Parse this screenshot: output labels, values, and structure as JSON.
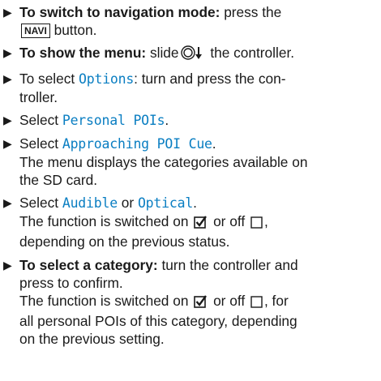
{
  "steps": [
    {
      "bold": "To switch to navigation mode:",
      "t1": " press the",
      "key": "NAVI",
      "t2": " button."
    },
    {
      "bold": "To show the menu:",
      "t1": " slide",
      "icon": "controller-slide-down-icon",
      "t2": " the controller."
    },
    {
      "t1": "To select ",
      "mono": "Options",
      "t2": ": turn and press the con-",
      "t3": "troller."
    },
    {
      "t1": "Select ",
      "mono": "Personal POIs",
      "t2": "."
    },
    {
      "t1": "Select ",
      "mono": "Approaching POI Cue",
      "t2": ".",
      "l2": "The menu displays the categories available on",
      "l3": "the SD card."
    },
    {
      "t1": "Select ",
      "mono1": "Audible",
      "t2": " or ",
      "mono2": "Optical",
      "t3": ".",
      "l2a": "The function is switched on",
      "l2b": " or off",
      "l2c": ",",
      "l3": "depending on the previous status."
    },
    {
      "bold": "To select a category:",
      "t1": " turn the controller and",
      "l2": "press to confirm.",
      "l3a": "The function is switched on",
      "l3b": " or off",
      "l3c": ", for",
      "l4": "all personal POIs of this category, depending",
      "l5": "on the previous setting."
    }
  ],
  "icons": {
    "bullet": "triangle-right-icon",
    "checked": "checked-box-icon",
    "unchecked": "empty-box-icon"
  },
  "colors": {
    "text": "#1a1a1a",
    "menu_item": "#0a7ec2"
  }
}
